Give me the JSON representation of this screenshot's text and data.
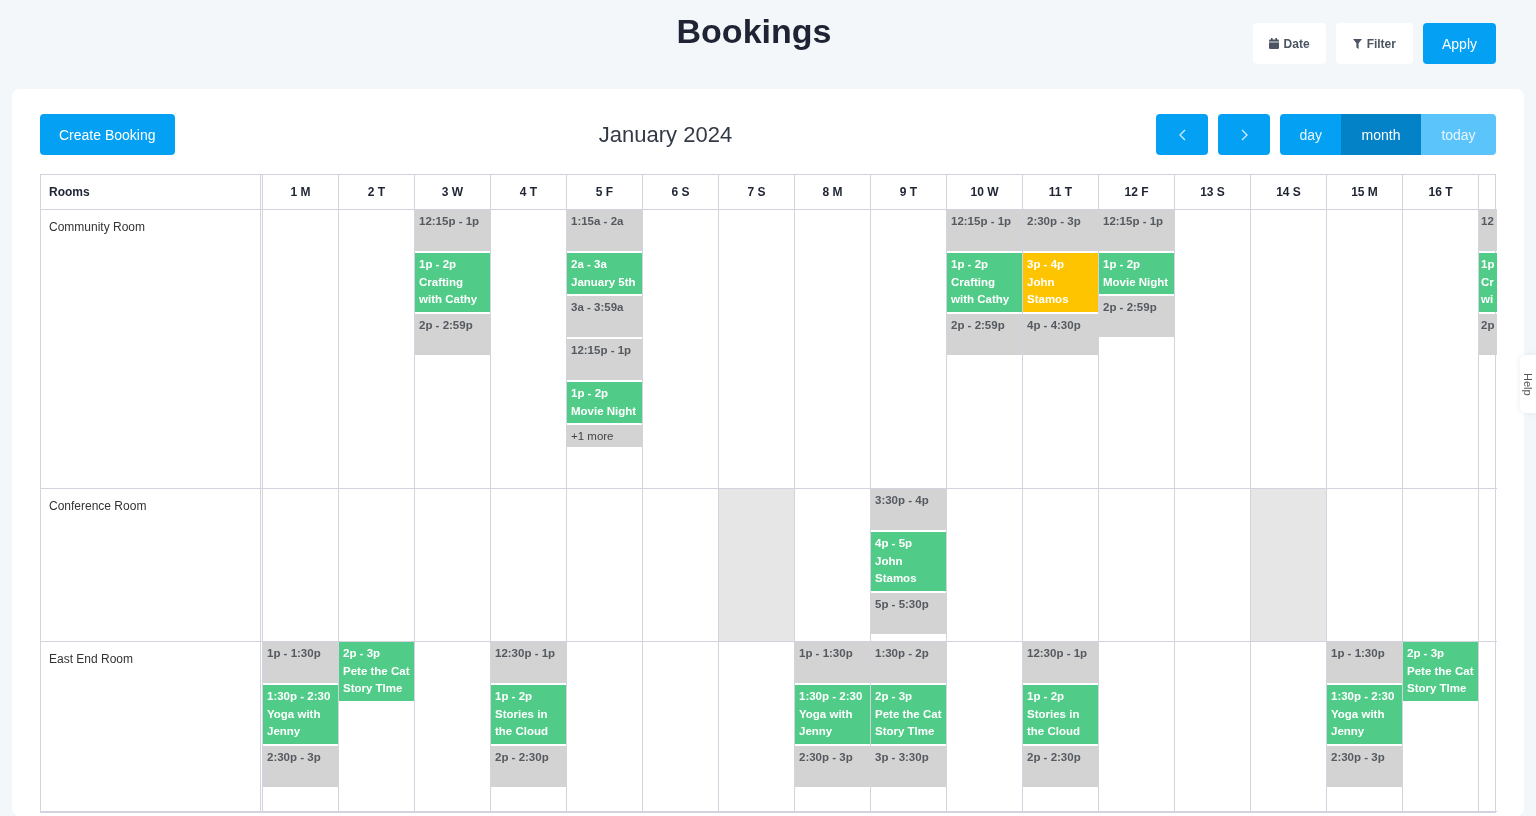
{
  "header": {
    "title": "Bookings",
    "buttons": [
      {
        "kind": "date",
        "label": "Date"
      },
      {
        "kind": "filter",
        "label": "Filter"
      },
      {
        "kind": "apply",
        "label": "Apply"
      }
    ]
  },
  "toolbar": {
    "create_label": "Create Booking",
    "month_title": "January 2024",
    "views": [
      {
        "label": "day",
        "selected": false,
        "disabled": false
      },
      {
        "label": "month",
        "selected": true,
        "disabled": false
      },
      {
        "label": "today",
        "selected": false,
        "disabled": true
      }
    ]
  },
  "calendar": {
    "rooms_heading": "Rooms",
    "days": [
      "1 M",
      "2 T",
      "3 W",
      "4 T",
      "5 F",
      "6 S",
      "7 S",
      "8 M",
      "9 T",
      "10 W",
      "11 T",
      "12 F",
      "13 S",
      "14 S",
      "15 M",
      "16 T"
    ],
    "rooms": [
      {
        "name": "Community Room",
        "cells": [
          {
            "shaded": false
          },
          {
            "shaded": false
          },
          {
            "shaded": false,
            "events": [
              {
                "kind": "open",
                "time": "12:15p - 1p"
              },
              {
                "kind": "booked",
                "time": "1p - 2p",
                "title": "Crafting with Cathy"
              },
              {
                "kind": "open",
                "time": "2p - 2:59p"
              }
            ]
          },
          {
            "shaded": false
          },
          {
            "shaded": false,
            "events": [
              {
                "kind": "open",
                "time": "1:15a - 2a"
              },
              {
                "kind": "booked",
                "time": "2a - 3a",
                "title": "January 5th"
              },
              {
                "kind": "open",
                "time": "3a - 3:59a"
              },
              {
                "kind": "open",
                "time": "12:15p - 1p"
              },
              {
                "kind": "booked",
                "time": "1p - 2p",
                "title": "Movie Night"
              },
              {
                "kind": "more",
                "time": "+1 more"
              }
            ]
          },
          {
            "shaded": false
          },
          {
            "shaded": false
          },
          {
            "shaded": false
          },
          {
            "shaded": false
          },
          {
            "shaded": false,
            "events": [
              {
                "kind": "open",
                "time": "12:15p - 1p"
              },
              {
                "kind": "booked",
                "time": "1p - 2p",
                "title": "Crafting with Cathy"
              },
              {
                "kind": "open",
                "time": "2p - 2:59p"
              }
            ]
          },
          {
            "shaded": false,
            "events": [
              {
                "kind": "open",
                "time": "2:30p - 3p"
              },
              {
                "kind": "pending",
                "time": "3p - 4p",
                "title": "John Stamos"
              },
              {
                "kind": "open",
                "time": "4p - 4:30p"
              }
            ]
          },
          {
            "shaded": false,
            "events": [
              {
                "kind": "open",
                "time": "12:15p - 1p"
              },
              {
                "kind": "booked",
                "time": "1p - 2p",
                "title": "Movie Night"
              },
              {
                "kind": "open",
                "time": "2p - 2:59p"
              }
            ]
          },
          {
            "shaded": false
          },
          {
            "shaded": false
          },
          {
            "shaded": false
          },
          {
            "shaded": false
          },
          {
            "shaded": false,
            "events": [
              {
                "kind": "open",
                "time": "12"
              },
              {
                "kind": "booked",
                "time": "1p",
                "title": "Cr\nwi"
              },
              {
                "kind": "open",
                "time": "2p"
              }
            ]
          }
        ]
      },
      {
        "name": "Conference Room",
        "cells": [
          {
            "shaded": false
          },
          {
            "shaded": false
          },
          {
            "shaded": false
          },
          {
            "shaded": false
          },
          {
            "shaded": false
          },
          {
            "shaded": false
          },
          {
            "shaded": true
          },
          {
            "shaded": false
          },
          {
            "shaded": false,
            "events": [
              {
                "kind": "open",
                "time": "3:30p - 4p"
              },
              {
                "kind": "booked",
                "time": "4p - 5p",
                "title": "John Stamos"
              },
              {
                "kind": "open",
                "time": "5p - 5:30p"
              }
            ]
          },
          {
            "shaded": false
          },
          {
            "shaded": false
          },
          {
            "shaded": false
          },
          {
            "shaded": false
          },
          {
            "shaded": true
          },
          {
            "shaded": false
          },
          {
            "shaded": false
          },
          {
            "shaded": false
          }
        ]
      },
      {
        "name": "East End Room",
        "cells": [
          {
            "shaded": false,
            "events": [
              {
                "kind": "open",
                "time": "1p - 1:30p"
              },
              {
                "kind": "booked",
                "time": "1:30p - 2:30",
                "title": "Yoga with Jenny"
              },
              {
                "kind": "open",
                "time": "2:30p - 3p"
              }
            ]
          },
          {
            "shaded": false,
            "events": [
              {
                "kind": "booked",
                "time": "2p - 3p",
                "title": "Pete the Cat Story TIme"
              }
            ]
          },
          {
            "shaded": false
          },
          {
            "shaded": false,
            "events": [
              {
                "kind": "open",
                "time": "12:30p - 1p"
              },
              {
                "kind": "booked",
                "time": "1p - 2p",
                "title": "Stories in the Cloud"
              },
              {
                "kind": "open",
                "time": "2p - 2:30p"
              }
            ]
          },
          {
            "shaded": false
          },
          {
            "shaded": false
          },
          {
            "shaded": false
          },
          {
            "shaded": false,
            "events": [
              {
                "kind": "open",
                "time": "1p - 1:30p"
              },
              {
                "kind": "booked",
                "time": "1:30p - 2:30",
                "title": "Yoga with Jenny"
              },
              {
                "kind": "open",
                "time": "2:30p - 3p"
              }
            ]
          },
          {
            "shaded": false,
            "events": [
              {
                "kind": "open",
                "time": "1:30p - 2p"
              },
              {
                "kind": "booked",
                "time": "2p - 3p",
                "title": "Pete the Cat Story TIme"
              },
              {
                "kind": "open",
                "time": "3p - 3:30p"
              }
            ]
          },
          {
            "shaded": false
          },
          {
            "shaded": false,
            "events": [
              {
                "kind": "open",
                "time": "12:30p - 1p"
              },
              {
                "kind": "booked",
                "time": "1p - 2p",
                "title": "Stories in the Cloud"
              },
              {
                "kind": "open",
                "time": "2p - 2:30p"
              }
            ]
          },
          {
            "shaded": false
          },
          {
            "shaded": false
          },
          {
            "shaded": false
          },
          {
            "shaded": false,
            "events": [
              {
                "kind": "open",
                "time": "1p - 1:30p"
              },
              {
                "kind": "booked",
                "time": "1:30p - 2:30",
                "title": "Yoga with Jenny"
              },
              {
                "kind": "open",
                "time": "2:30p - 3p"
              }
            ]
          },
          {
            "shaded": false,
            "events": [
              {
                "kind": "booked",
                "time": "2p - 3p",
                "title": "Pete the Cat Story TIme"
              }
            ]
          },
          {
            "shaded": false
          }
        ]
      }
    ]
  },
  "help_tab": {
    "label": "Help"
  }
}
